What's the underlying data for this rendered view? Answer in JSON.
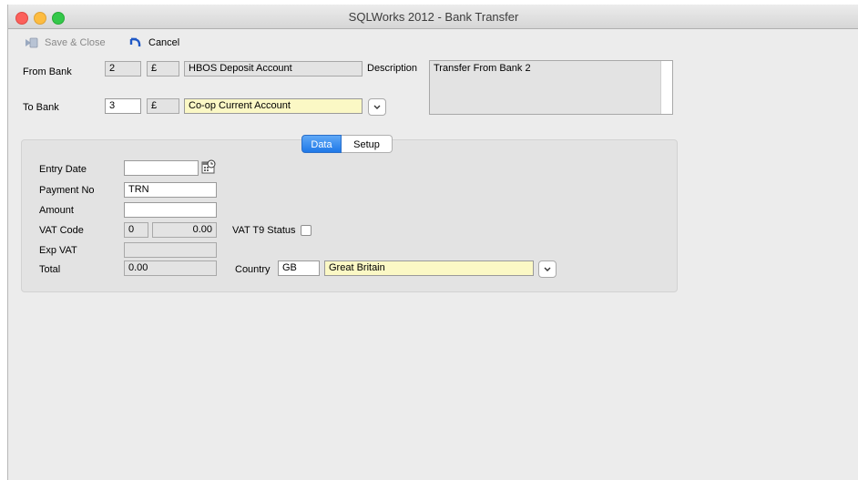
{
  "window": {
    "title": "SQLWorks 2012 - Bank Transfer"
  },
  "toolbar": {
    "save_close": "Save & Close",
    "cancel": "Cancel"
  },
  "from_bank": {
    "label": "From Bank",
    "code": "2",
    "currency": "£",
    "name": "HBOS Deposit Account"
  },
  "to_bank": {
    "label": "To Bank",
    "code": "3",
    "currency": "£",
    "name": "Co-op Current Account"
  },
  "description": {
    "label": "Description",
    "value": "Transfer From Bank 2"
  },
  "tabs": [
    {
      "label": "Data",
      "active": true
    },
    {
      "label": "Setup",
      "active": false
    }
  ],
  "form": {
    "entry_date": {
      "label": "Entry Date",
      "value": ""
    },
    "payment_no": {
      "label": "Payment No",
      "value": "TRN"
    },
    "amount": {
      "label": "Amount",
      "value": ""
    },
    "vat_code": {
      "label": "VAT Code",
      "code": "0",
      "rate": "0.00"
    },
    "vat_t9": {
      "label": "VAT T9 Status",
      "checked": false
    },
    "exp_vat": {
      "label": "Exp VAT",
      "value": ""
    },
    "total": {
      "label": "Total",
      "value": "0.00"
    },
    "country": {
      "label": "Country",
      "code": "GB",
      "name": "Great Britain"
    }
  },
  "colors": {
    "active_tab": "#1f78e8",
    "lookup_field": "#fbf8c5",
    "readonly_field": "#e3e3e3"
  }
}
